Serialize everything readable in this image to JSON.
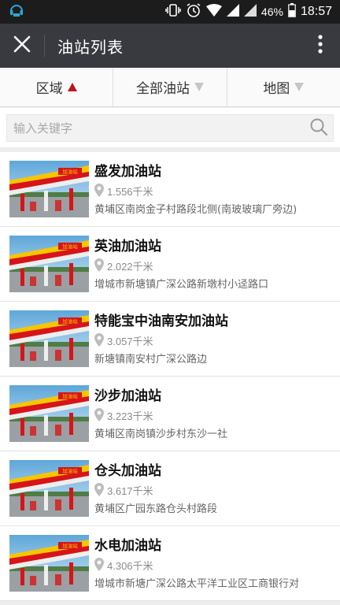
{
  "status_bar": {
    "battery_percent": "46%",
    "time": "18:57"
  },
  "header": {
    "title": "油站列表"
  },
  "filters": [
    {
      "label": "区域"
    },
    {
      "label": "全部油站"
    },
    {
      "label": "地图"
    }
  ],
  "search": {
    "placeholder": "输入关键字",
    "value": ""
  },
  "stations": [
    {
      "name": "盛发加油站",
      "distance": "1.556千米",
      "address": "黄埔区南岗金子村路段北侧(南玻玻璃厂旁边)",
      "sign": "加油站"
    },
    {
      "name": "英油加油站",
      "distance": "2.022千米",
      "address": "增城市新塘镇广深公路新墩村小迳路口",
      "sign": "加油站"
    },
    {
      "name": "特能宝中油南安加油站",
      "distance": "3.057千米",
      "address": "新塘镇南安村广深公路边",
      "sign": "加油站"
    },
    {
      "name": "沙步加油站",
      "distance": "3.223千米",
      "address": "黄埔区南岗镇沙步村东沙一社",
      "sign": "加油站"
    },
    {
      "name": "仓头加油站",
      "distance": "3.617千米",
      "address": "黄埔区广园东路仓头村路段",
      "sign": "加油站"
    },
    {
      "name": "水电加油站",
      "distance": "4.306千米",
      "address": "增城市新塘广深公路太平洋工业区工商银行对",
      "sign": "加油站"
    }
  ],
  "colors": {
    "appbar": "#393a3f",
    "statusbar": "#1c1c1c",
    "active_arrow": "#c1121f",
    "inactive_arrow": "#c6c6c6",
    "station_red": "#d7141a",
    "station_yellow": "#f7c600"
  }
}
